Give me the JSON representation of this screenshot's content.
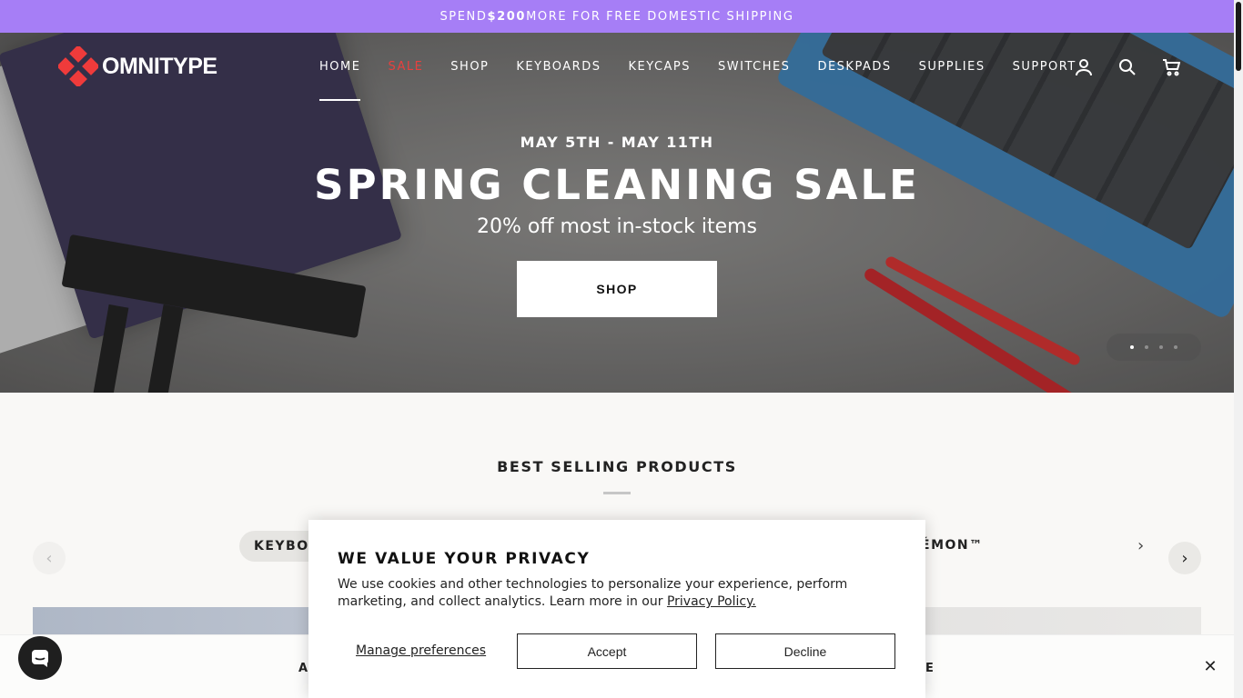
{
  "announcement": {
    "prefix": "SPEND ",
    "amount": "$200",
    "suffix": " MORE FOR FREE DOMESTIC SHIPPING"
  },
  "brand": {
    "name": "OMNITYPE",
    "accent": "#ef3b3b"
  },
  "nav": {
    "items": [
      {
        "label": "HOME"
      },
      {
        "label": "SALE"
      },
      {
        "label": "SHOP"
      },
      {
        "label": "KEYBOARDS"
      },
      {
        "label": "KEYCAPS"
      },
      {
        "label": "SWITCHES"
      },
      {
        "label": "DESKPADS"
      },
      {
        "label": "SUPPLIES"
      },
      {
        "label": "SUPPORT"
      }
    ],
    "icons": [
      "account-icon",
      "search-icon",
      "cart-icon"
    ]
  },
  "hero": {
    "date": "MAY 5TH - MAY 11TH",
    "title": "SPRING CLEANING SALE",
    "subtitle": "20% off most in-stock items",
    "cta": "SHOP",
    "slide_count": 4,
    "active_slide": 1
  },
  "best_sellers": {
    "title": "BEST SELLING PRODUCTS",
    "tab_left": "KEYBOA",
    "tab_right": "ÉMON™"
  },
  "bottom_bar": {
    "left": "A",
    "right": "E"
  },
  "privacy": {
    "title": "WE VALUE YOUR PRIVACY",
    "body": "We use cookies and other technologies to personalize your experience, perform marketing, and collect analytics. Learn more in our ",
    "link": "Privacy Policy.",
    "manage": "Manage preferences",
    "accept": "Accept",
    "decline": "Decline"
  },
  "colors": {
    "announcement_bg": "#a67ef6",
    "sale_red": "#e8403e"
  }
}
